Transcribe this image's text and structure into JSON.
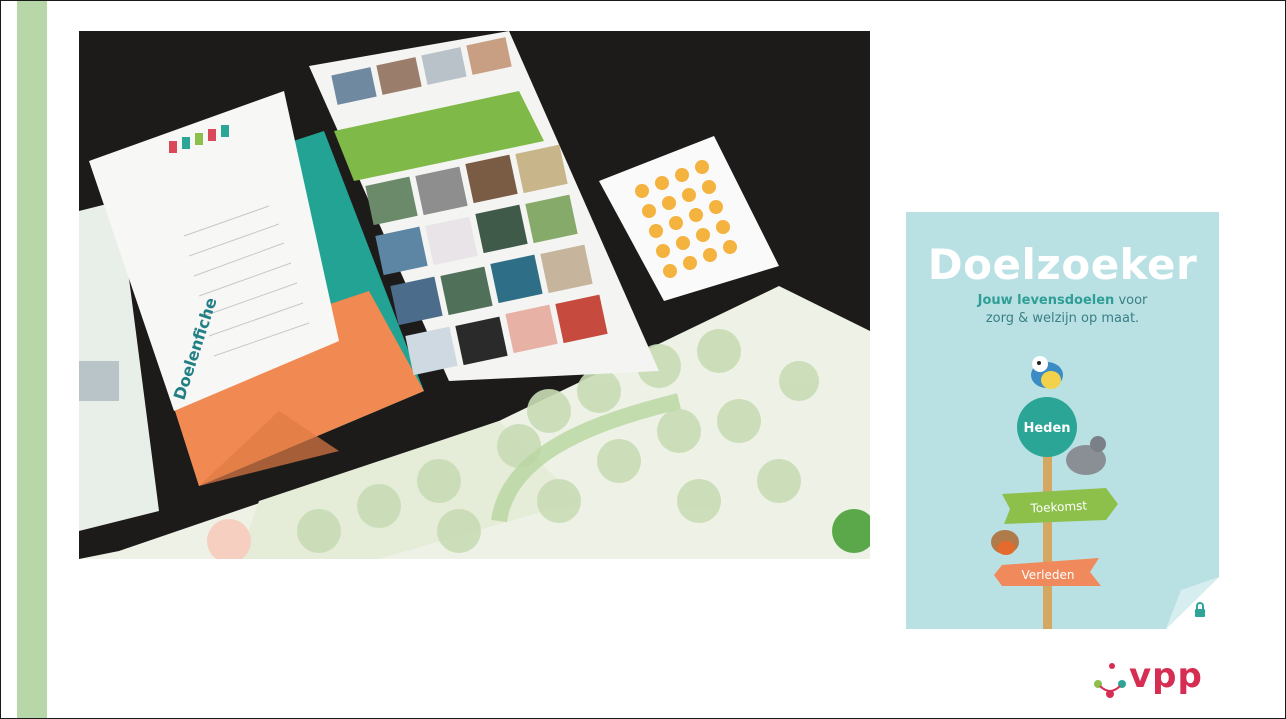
{
  "slide": {
    "photo": {
      "fiche_title": "Doelenfiche"
    },
    "cover": {
      "title": "Doelzoeker",
      "subtitle_bold": "Jouw levensdoelen",
      "subtitle_rest": " voor",
      "subtitle_line2": "zorg & welzijn op maat.",
      "sign_top": "Heden",
      "sign_middle": "Toekomst",
      "sign_bottom": "Verleden"
    },
    "logo": {
      "text": "vpp"
    }
  },
  "colors": {
    "left_bar": "#b7d7a8",
    "cover_bg": "#b9e1e3",
    "teal": "#2fa59a",
    "green_sign": "#8cc04b",
    "orange_sign": "#f08a5d",
    "logo_red": "#d62e52"
  }
}
